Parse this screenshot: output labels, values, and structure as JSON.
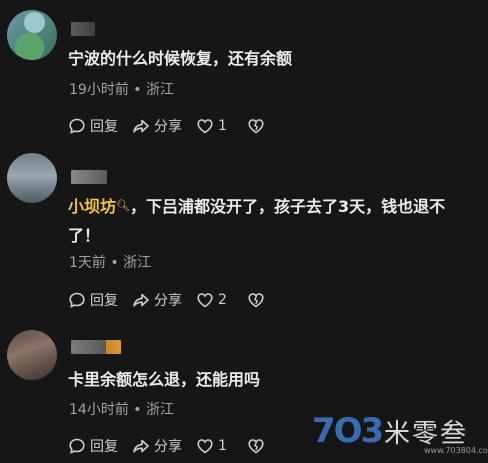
{
  "comments": [
    {
      "text": "宁波的什么时候恢复，还有余额",
      "meta": "19小时前 • 浙江",
      "reply_label": "回复",
      "share_label": "分享",
      "likes": "1"
    },
    {
      "mention": "小坝坊",
      "text_line1": "，下吕浦都没开了，孩子去了3天，钱也退不",
      "text_line2": "了！",
      "meta": "1天前 • 浙江",
      "reply_label": "回复",
      "share_label": "分享",
      "likes": "2"
    },
    {
      "text": "卡里余额怎么退，还能用吗",
      "meta": "14小时前 • 浙江",
      "reply_label": "回复",
      "share_label": "分享",
      "likes": "1"
    }
  ],
  "watermark": {
    "number": "7O3",
    "name": "米零叁",
    "url": "www.703804.com"
  },
  "icons": {
    "reply": "speech-bubble-icon",
    "share": "share-arrow-icon",
    "like": "heart-icon",
    "dislike": "broken-heart-icon",
    "mention": "search-icon"
  }
}
